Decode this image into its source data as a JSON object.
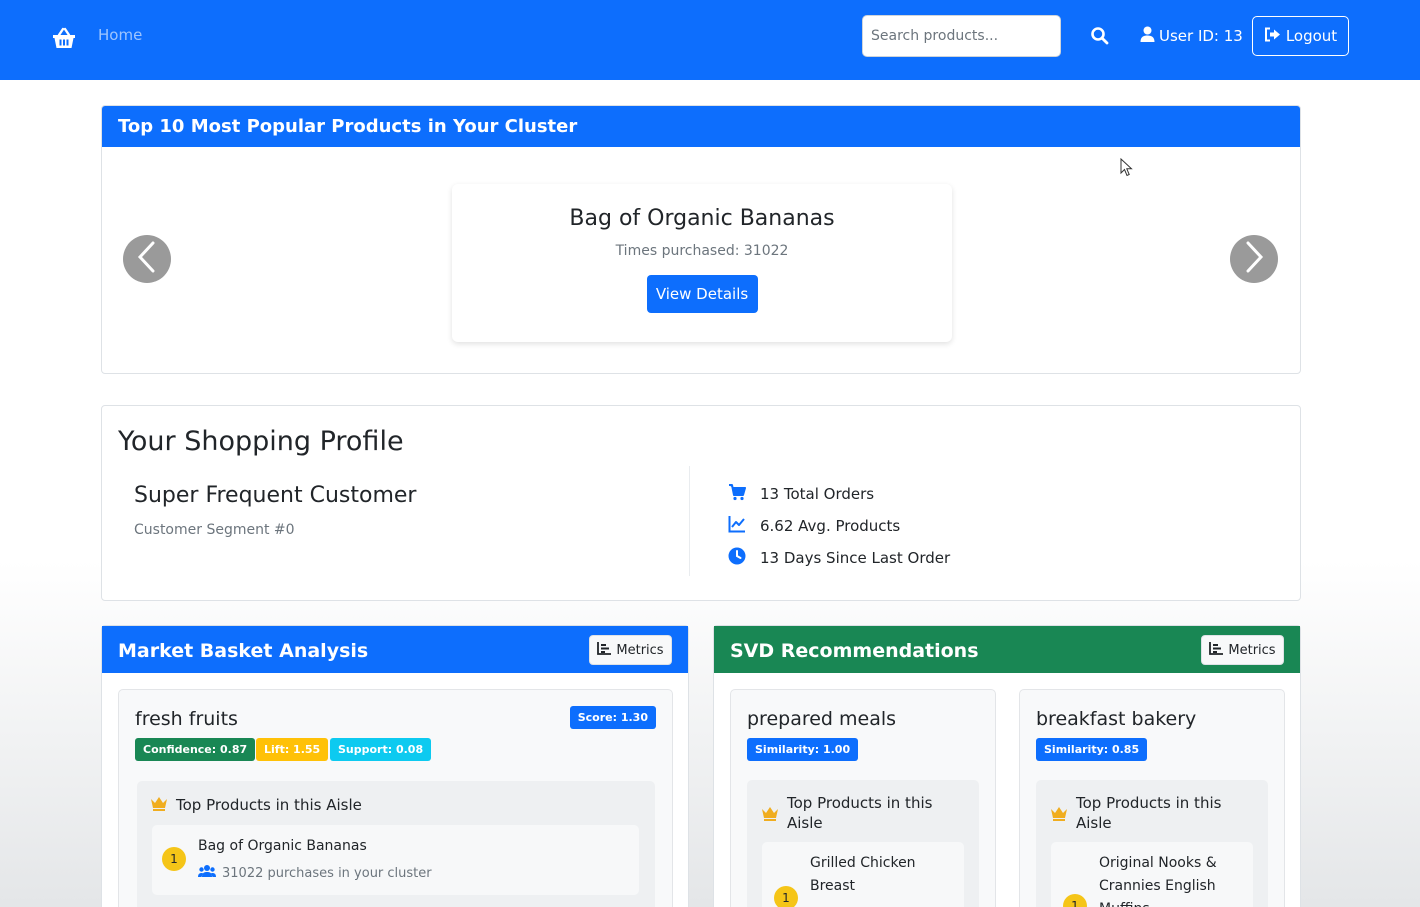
{
  "navbar": {
    "brand_icon": "basket-icon",
    "home_label": "Home",
    "search_placeholder": "Search products...",
    "user_label": "User ID: 13",
    "logout_label": "Logout",
    "color": "#0d6efd"
  },
  "popular": {
    "header": "Top 10 Most Popular Products in Your Cluster",
    "product_name": "Bag of Organic Bananas",
    "times_purchased": "Times purchased: 31022",
    "button_label": "View Details"
  },
  "profile": {
    "title": "Your Shopping Profile",
    "segment_name": "Super Frequent Customer",
    "segment_sub": "Customer Segment #0",
    "stats": [
      {
        "icon": "cart-icon",
        "text": "13 Total Orders"
      },
      {
        "icon": "chart-line-icon",
        "text": "6.62 Avg. Products"
      },
      {
        "icon": "clock-icon",
        "text": "13 Days Since Last Order"
      }
    ]
  },
  "mba": {
    "header": "Market Basket Analysis",
    "metrics_label": "Metrics",
    "color": "#0d6efd",
    "aisle": {
      "name": "fresh fruits",
      "score": "Score: 1.30",
      "confidence": "Confidence: 0.87",
      "lift": "Lift: 1.55",
      "support": "Support: 0.08",
      "top_header": "Top Products in this Aisle",
      "products": [
        {
          "rank": "1",
          "name": "Bag of Organic Bananas",
          "meta": "31022 purchases in your cluster"
        }
      ]
    }
  },
  "svd": {
    "header": "SVD Recommendations",
    "metrics_label": "Metrics",
    "color": "#198754",
    "aisles": [
      {
        "name": "prepared meals",
        "similarity": "Similarity: 1.00",
        "top_header": "Top Products in this Aisle",
        "product": {
          "rank": "1",
          "name": "Grilled Chicken Breast"
        }
      },
      {
        "name": "breakfast bakery",
        "similarity": "Similarity: 0.85",
        "top_header": "Top Products in this Aisle",
        "product": {
          "rank": "1",
          "name": "Original Nooks & Crannies English Muffins"
        }
      }
    ]
  }
}
